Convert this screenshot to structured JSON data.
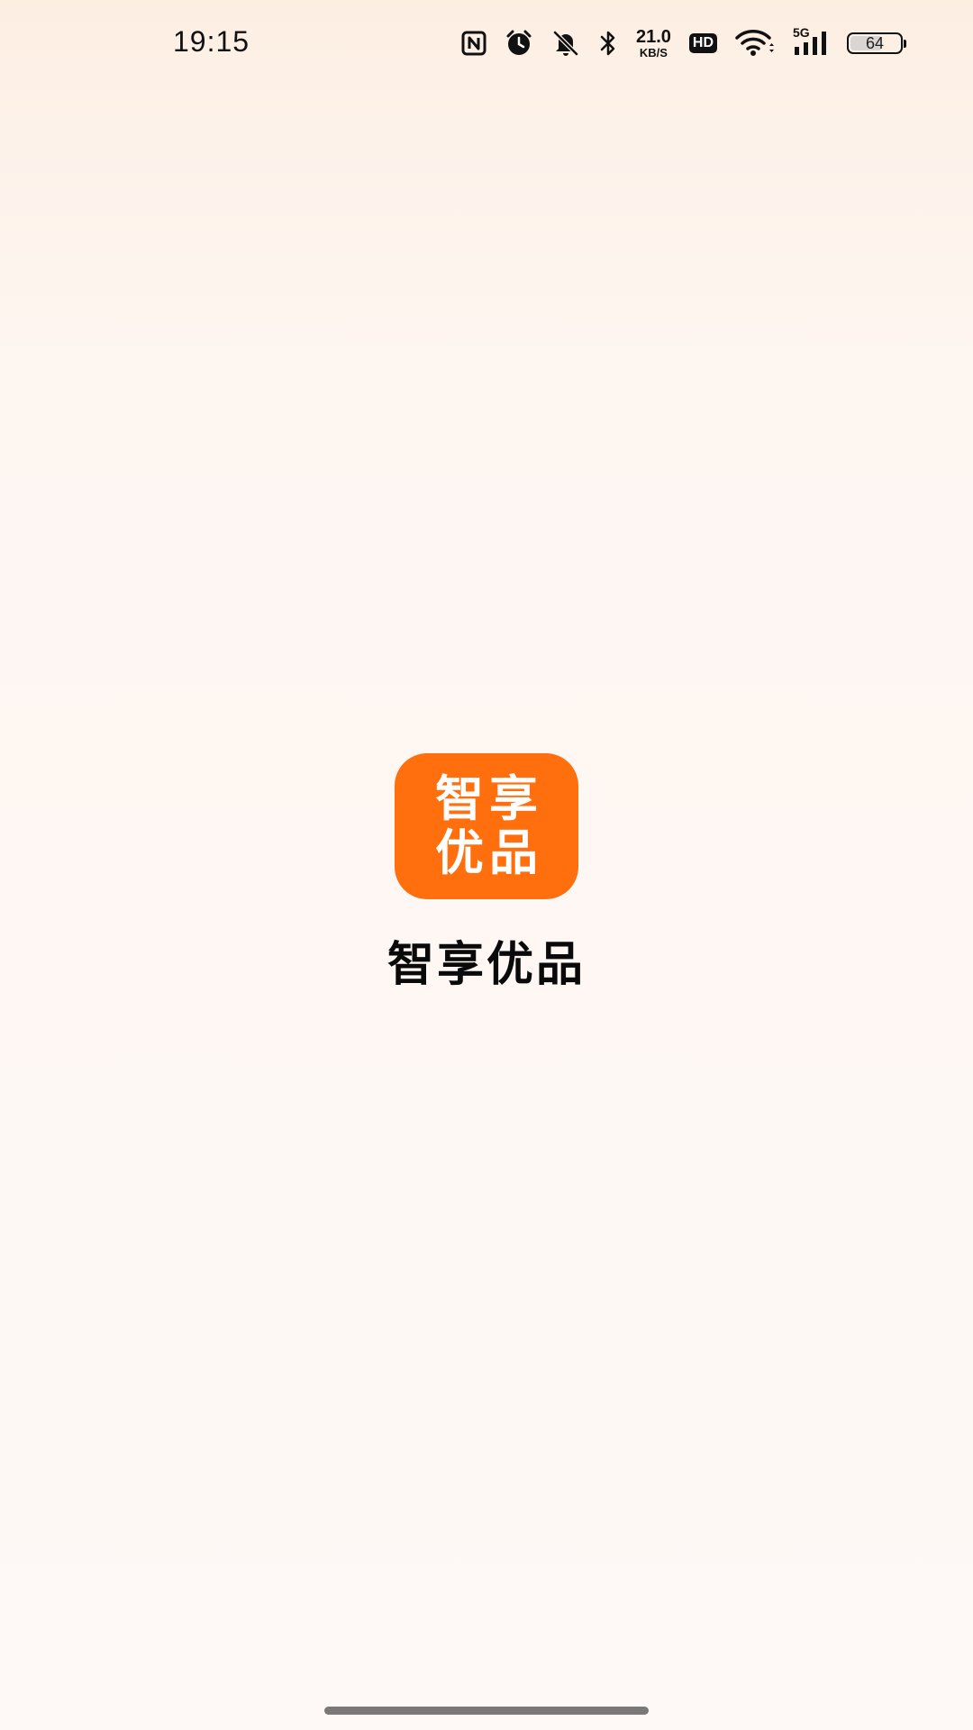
{
  "status_bar": {
    "time": "19:15",
    "net_speed_value": "21.0",
    "net_speed_unit": "KB/S",
    "hd_label": "HD",
    "network_label": "5G",
    "battery_level": "64",
    "battery_fraction": 0.64,
    "icons": [
      "nfc-icon",
      "alarm-icon",
      "mute-bell-icon",
      "bluetooth-icon",
      "wifi-icon",
      "signal-icon",
      "battery-icon"
    ]
  },
  "splash": {
    "logo_line1": "智享",
    "logo_line2": "优品",
    "app_name": "智享优品",
    "brand_color": "#ff6f0e"
  }
}
